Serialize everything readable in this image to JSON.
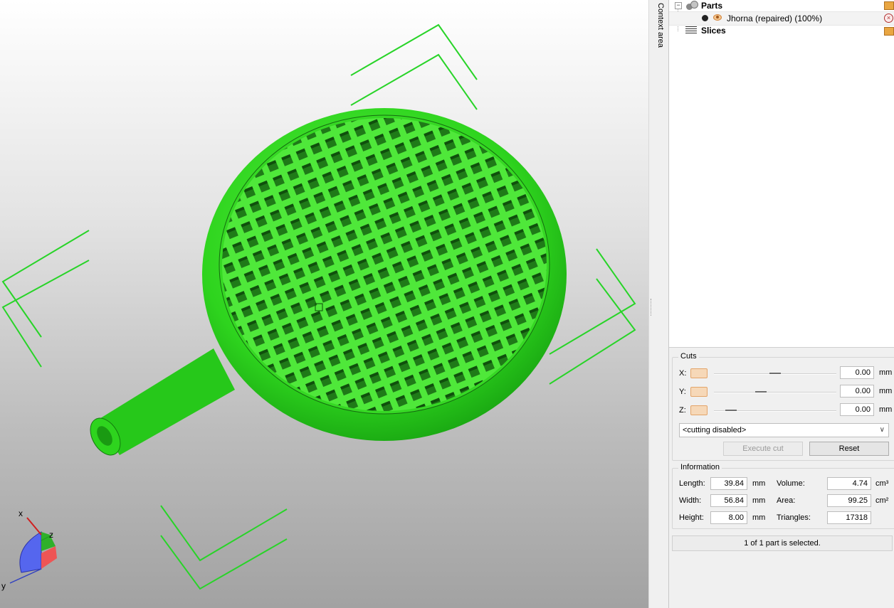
{
  "viewport": {
    "model_color": "#33dd22",
    "bracket_color": "#28d428",
    "axis_labels": {
      "x": "x",
      "y": "y",
      "z": "z"
    }
  },
  "context_tab": {
    "label": "Context area"
  },
  "tree": {
    "parts_label": "Parts",
    "part_name": "Jhorna (repaired) (100%)",
    "slices_label": "Slices",
    "icons": [
      "collapse-icon",
      "parts-icon",
      "visibility-dot-icon",
      "eye-icon",
      "folder-icon",
      "remove-icon",
      "slices-icon"
    ]
  },
  "cuts": {
    "title": "Cuts",
    "x_label": "X:",
    "y_label": "Y:",
    "z_label": "Z:",
    "x_value": "0.00",
    "y_value": "0.00",
    "z_value": "0.00",
    "unit": "mm",
    "mode_selected": "<cutting disabled>",
    "execute_label": "Execute cut",
    "reset_label": "Reset"
  },
  "information": {
    "title": "Information",
    "length_label": "Length:",
    "length_value": "39.84",
    "width_label": "Width:",
    "width_value": "56.84",
    "height_label": "Height:",
    "height_value": "8.00",
    "dim_unit": "mm",
    "volume_label": "Volume:",
    "volume_value": "4.74",
    "volume_unit": "cm³",
    "area_label": "Area:",
    "area_value": "99.25",
    "area_unit": "cm²",
    "triangles_label": "Triangles:",
    "triangles_value": "17318"
  },
  "status": {
    "text": "1 of 1 part is selected."
  }
}
